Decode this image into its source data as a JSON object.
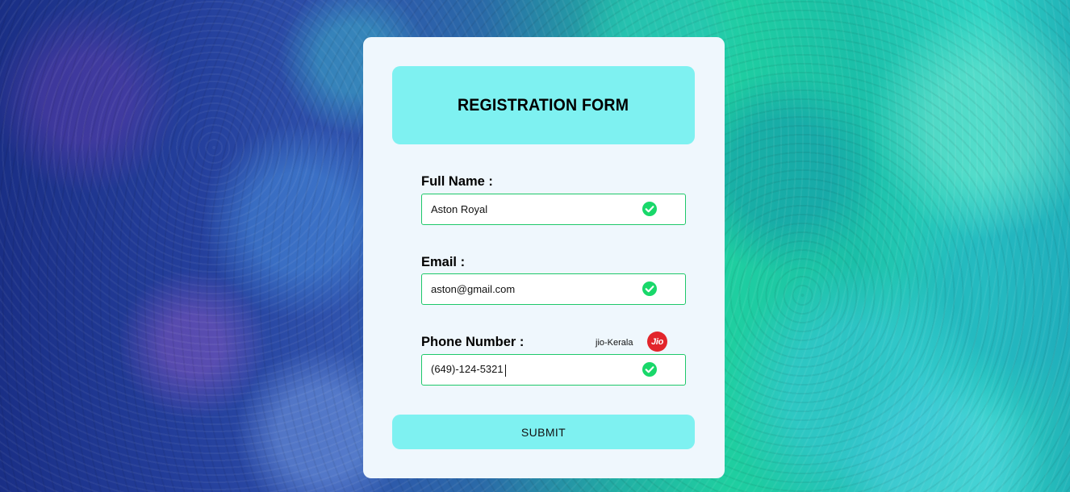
{
  "form": {
    "title": "REGISTRATION FORM",
    "fields": [
      {
        "label": "Full Name :",
        "value": "Aston Royal",
        "valid": true,
        "check_icon": "check-circle-icon"
      },
      {
        "label": "Email :",
        "value": "aston@gmail.com",
        "valid": true,
        "check_icon": "check-circle-icon"
      },
      {
        "label": "Phone Number :",
        "value": "(649)-124-5321",
        "valid": true,
        "check_icon": "check-circle-icon"
      }
    ],
    "phone_carrier": {
      "label": "jio-Kerala",
      "logo_text": "Jio",
      "logo_color": "#e2252b"
    },
    "submit_label": "SUBMIT"
  },
  "colors": {
    "accent": "#7ef1f1",
    "card_background": "#eff7fd",
    "valid_border": "#1ec86a",
    "check_green": "#19d86a"
  }
}
